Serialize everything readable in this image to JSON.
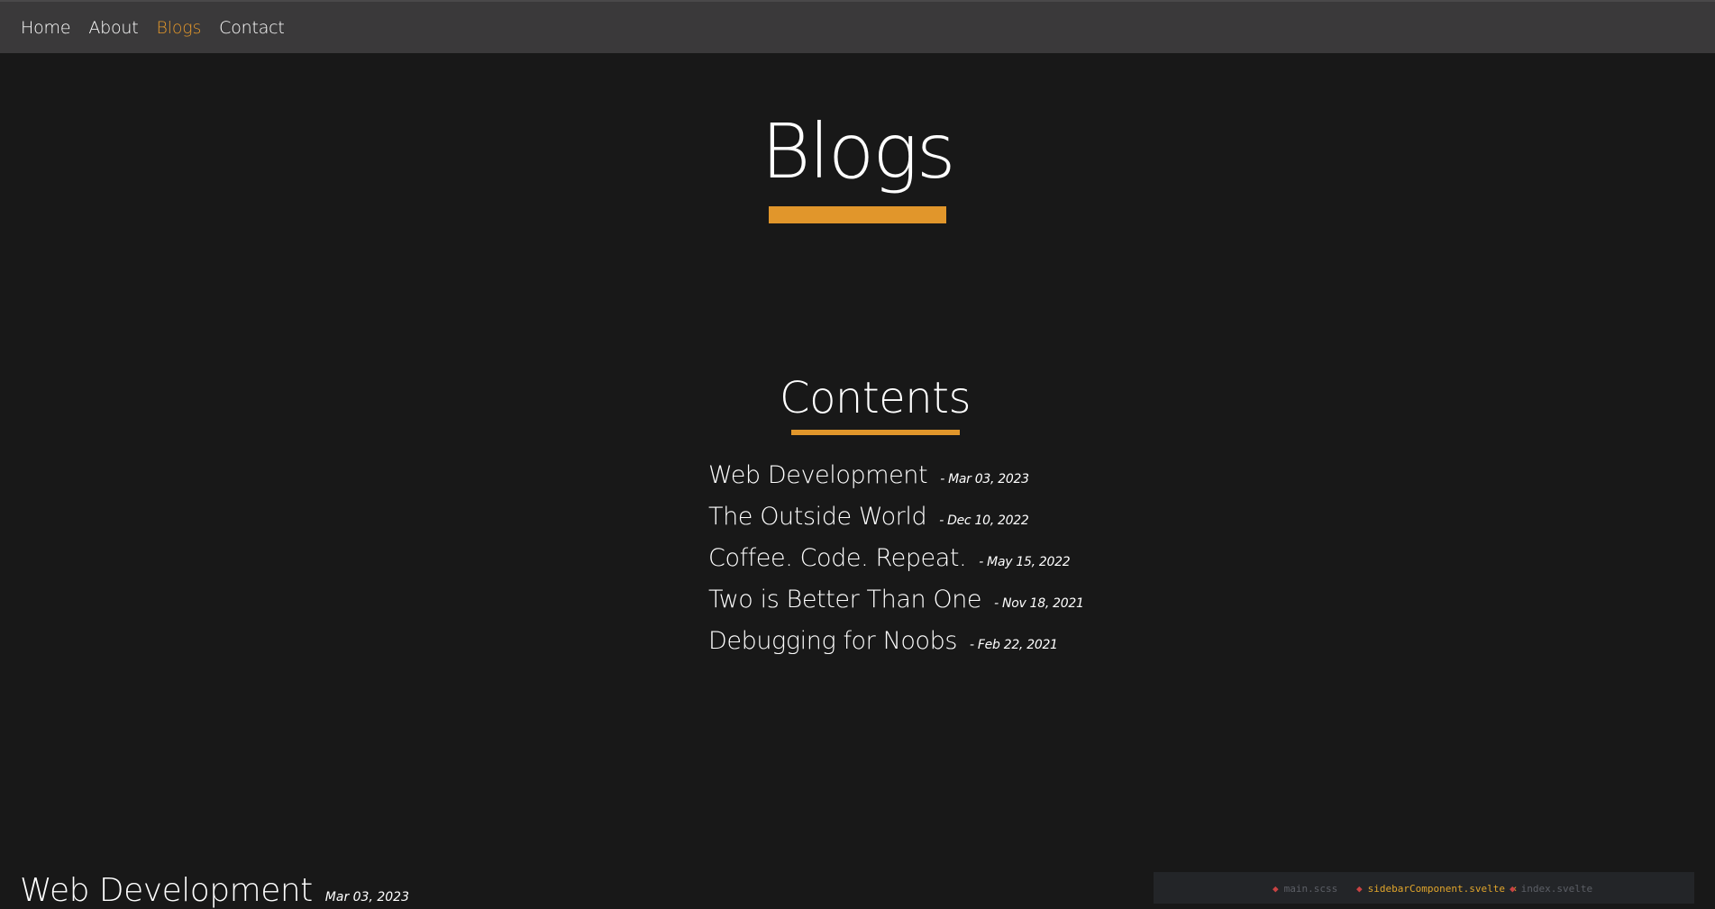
{
  "nav": {
    "items": [
      {
        "label": "Home",
        "active": false
      },
      {
        "label": "About",
        "active": false
      },
      {
        "label": "Blogs",
        "active": true
      },
      {
        "label": "Contact",
        "active": false
      }
    ]
  },
  "page": {
    "title": "Blogs"
  },
  "contents": {
    "heading": "Contents",
    "items": [
      {
        "title": "Web Development",
        "date": "- Mar 03, 2023"
      },
      {
        "title": "The Outside World",
        "date": "- Dec 10, 2022"
      },
      {
        "title": "Coffee. Code. Repeat.",
        "date": "- May 15, 2022"
      },
      {
        "title": "Two is Better Than One",
        "date": "- Nov 18, 2021"
      },
      {
        "title": "Debugging for Noobs",
        "date": "- Feb 22, 2021"
      }
    ]
  },
  "first_post": {
    "title": "Web Development",
    "date": "Mar 03, 2023",
    "image_tabs": [
      {
        "label": "main.scss",
        "active": false
      },
      {
        "label": "sidebarComponent.svelte ×",
        "active": true
      },
      {
        "label": "index.svelte",
        "active": false
      }
    ]
  },
  "colors": {
    "accent": "#e1962b",
    "background": "#181818",
    "navbar": "#3a393a",
    "text": "#ffffff"
  }
}
